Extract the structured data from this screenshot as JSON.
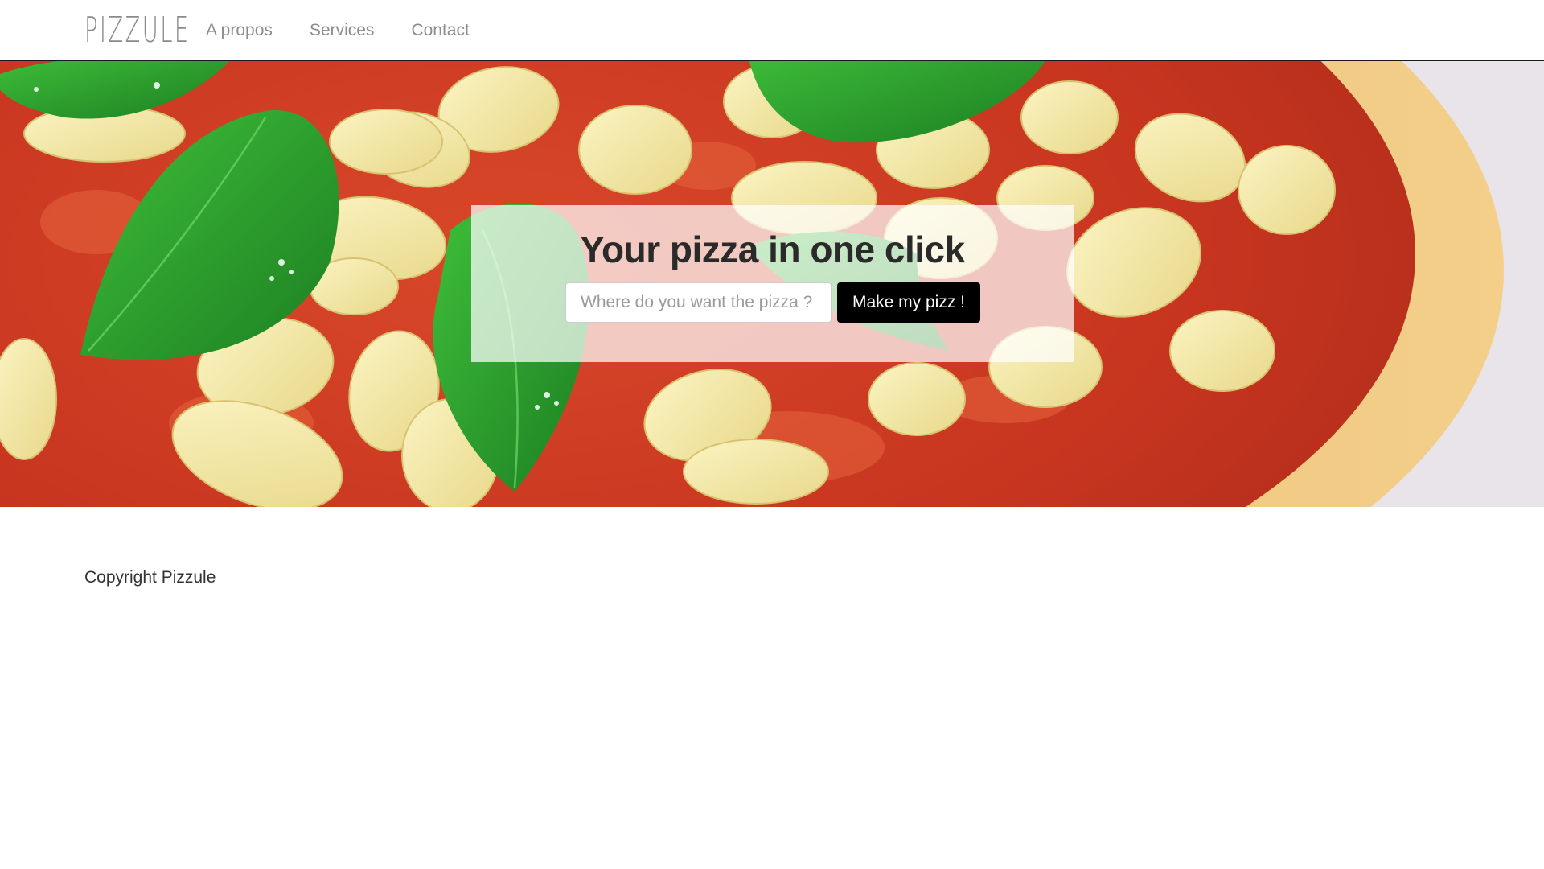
{
  "navbar": {
    "brand": "PIZZULE",
    "links": [
      {
        "label": "A propos"
      },
      {
        "label": "Services"
      },
      {
        "label": "Contact"
      }
    ]
  },
  "hero": {
    "title": "Your pizza in one click",
    "input_placeholder": "Where do you want the pizza ?",
    "input_value": "",
    "button_label": "Make my pizz !"
  },
  "footer": {
    "copyright": "Copyright Pizzule"
  },
  "colors": {
    "nav_text": "#8c8c8c",
    "button_bg": "#000000",
    "button_text": "#ffffff",
    "title_text": "#2a2a2a"
  }
}
